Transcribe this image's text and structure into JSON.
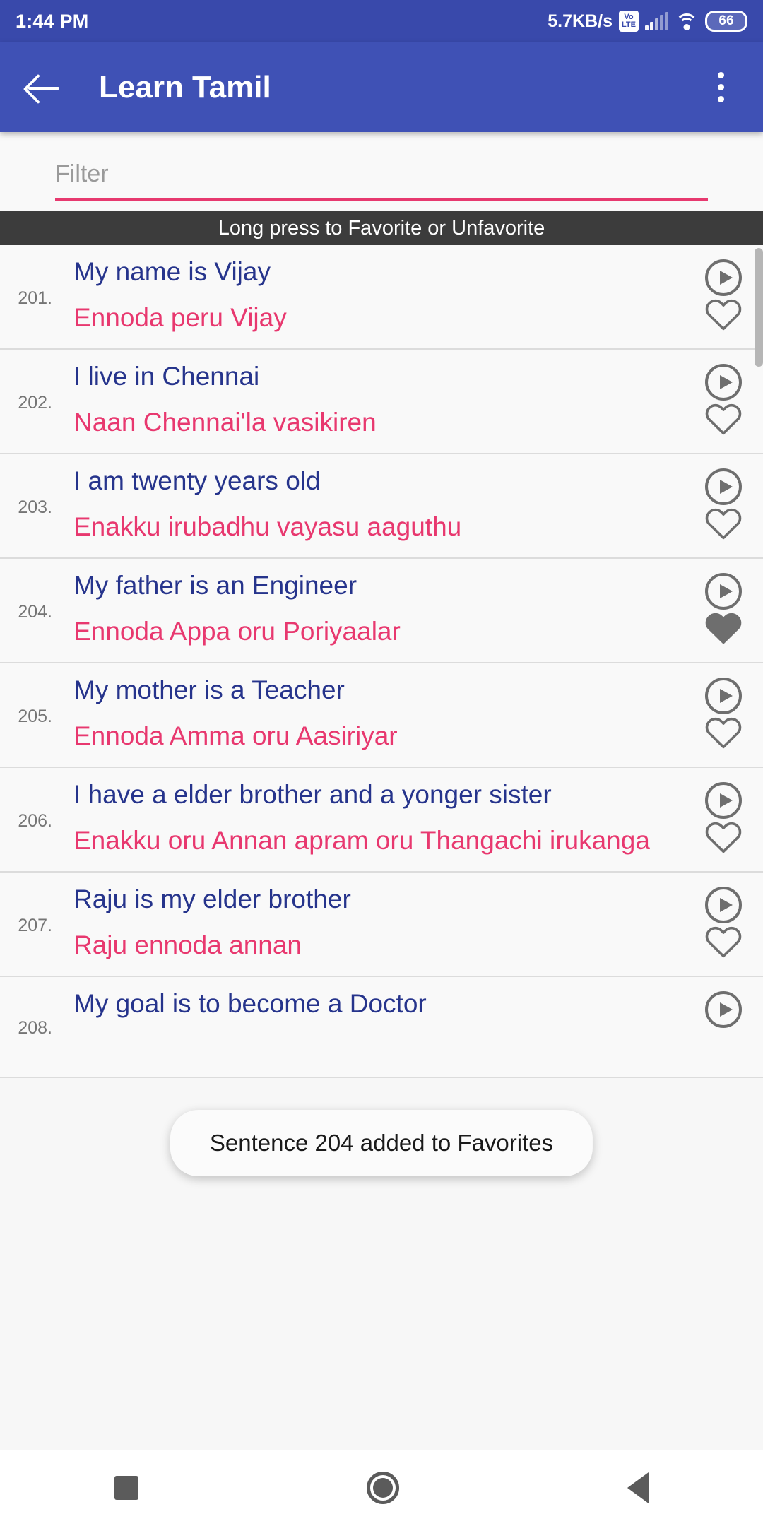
{
  "status_bar": {
    "time": "1:44 PM",
    "network_speed": "5.7KB/s",
    "volte_top": "Vo",
    "volte_bottom": "LTE",
    "battery_level": "66"
  },
  "app_bar": {
    "title": "Learn Tamil",
    "back_icon": "back-arrow-icon",
    "overflow_icon": "overflow-menu-icon"
  },
  "filter": {
    "value": "",
    "placeholder": "Filter"
  },
  "hint_banner": {
    "text": "Long press to Favorite or Unfavorite"
  },
  "toast": {
    "message": "Sentence 204 added to Favorites"
  },
  "colors": {
    "status_bar": "#3949ab",
    "app_bar": "#3f51b5",
    "english_text": "#26348c",
    "tamil_text": "#e8386f",
    "accent_underline": "#e7396f",
    "hint_background": "#3c3c3c",
    "icon_gray": "#6e6e6e"
  },
  "list": {
    "rows": [
      {
        "number": "201.",
        "english": "My name is Vijay",
        "tamil": "Ennoda peru Vijay",
        "favorite": false
      },
      {
        "number": "202.",
        "english": "I live in Chennai",
        "tamil": "Naan Chennai'la vasikiren",
        "favorite": false
      },
      {
        "number": "203.",
        "english": "I am twenty years old",
        "tamil": "Enakku irubadhu vayasu aaguthu",
        "favorite": false
      },
      {
        "number": "204.",
        "english": "My father is an Engineer",
        "tamil": "Ennoda Appa oru Poriyaalar",
        "favorite": true
      },
      {
        "number": "205.",
        "english": "My mother is a Teacher",
        "tamil": "Ennoda Amma oru Aasiriyar",
        "favorite": false
      },
      {
        "number": "206.",
        "english": "I have a elder brother and a yonger sister",
        "tamil": "Enakku oru Annan apram oru Thangachi irukanga",
        "favorite": false
      },
      {
        "number": "207.",
        "english": "Raju is my elder brother",
        "tamil": "Raju ennoda annan",
        "favorite": false
      },
      {
        "number": "208.",
        "english": "My goal is to become a Doctor",
        "tamil": "",
        "favorite": false
      }
    ]
  },
  "nav_bar": {
    "recents_icon": "square-recents-icon",
    "home_icon": "circle-home-icon",
    "back_icon": "triangle-back-icon"
  }
}
